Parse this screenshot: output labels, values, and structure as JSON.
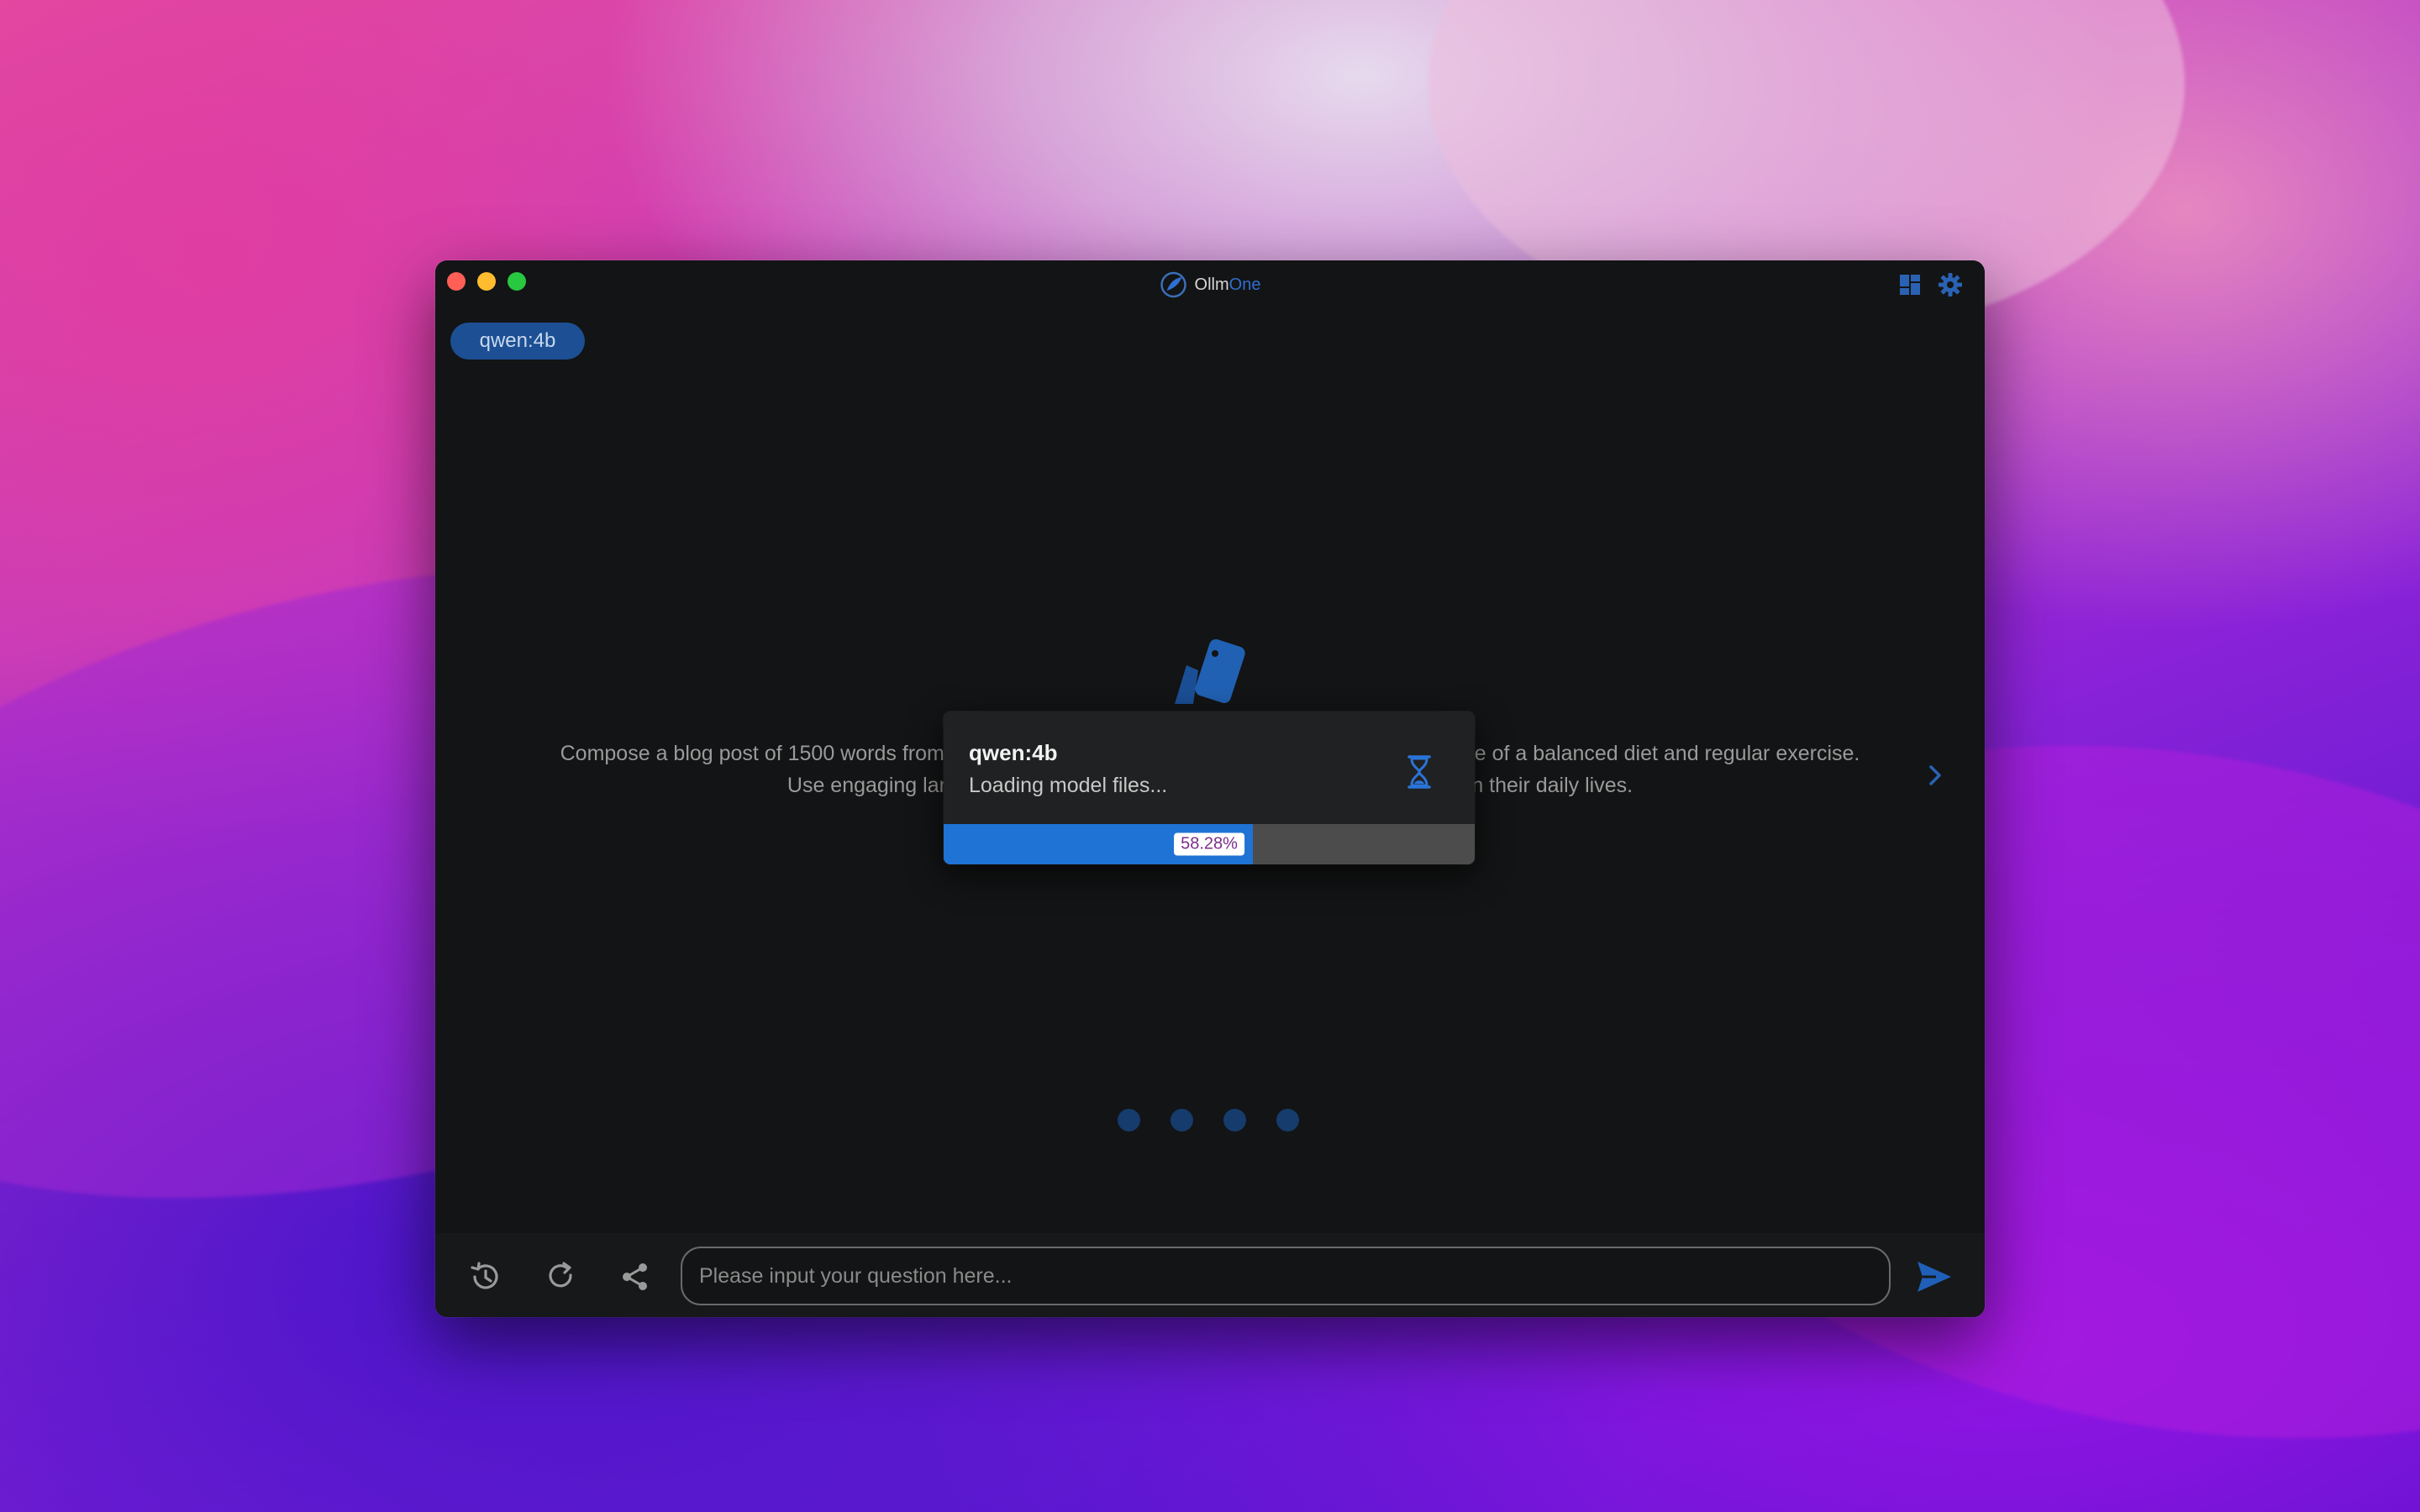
{
  "app": {
    "title_prefix": "Ollm",
    "title_suffix": "One"
  },
  "model_pill": {
    "label": "qwen:4b"
  },
  "carousel": {
    "text": "Compose a blog post of 1500 words from the perspective of a nutritionist, explaining the importance of a balanced diet and regular exercise. Use engaging language and provide practical tips that readers can apply in their daily lives.",
    "dot_count": 4
  },
  "popup": {
    "title": "qwen:4b",
    "status": "Loading model files...",
    "progress_label": "58.28%",
    "progress_value": 58.28
  },
  "input": {
    "placeholder": "Please input your question here..."
  },
  "icons": {
    "dashboard": "dashboard-icon",
    "settings": "gear-icon",
    "history": "history-icon",
    "refresh": "refresh-icon",
    "share": "share-icon",
    "send": "send-icon",
    "hourglass": "hourglass-icon",
    "next": "chevron-right-icon"
  },
  "colors": {
    "accent": "#1e73d4",
    "pill": "#1c4f93",
    "progress_track": "#4c4c4c",
    "progress_text": "#7b2e8a"
  }
}
